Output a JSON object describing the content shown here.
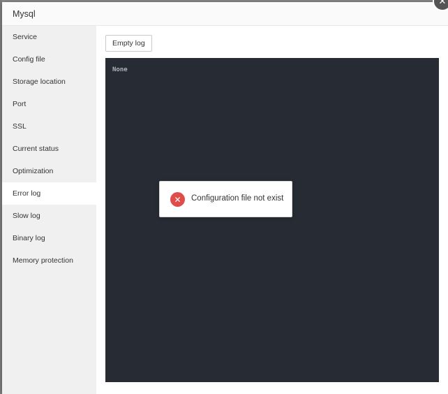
{
  "dialog": {
    "title": "Mysql",
    "close_icon": "close-icon"
  },
  "sidebar": {
    "items": [
      {
        "label": "Service"
      },
      {
        "label": "Config file"
      },
      {
        "label": "Storage location"
      },
      {
        "label": "Port"
      },
      {
        "label": "SSL"
      },
      {
        "label": "Current status"
      },
      {
        "label": "Optimization"
      },
      {
        "label": "Error log",
        "active": true
      },
      {
        "label": "Slow log"
      },
      {
        "label": "Binary log"
      },
      {
        "label": "Memory protection"
      }
    ]
  },
  "main": {
    "empty_log_label": "Empty log",
    "log_content": "None"
  },
  "toast": {
    "message": "Configuration file not exist",
    "icon": "error-icon"
  },
  "colors": {
    "log_background": "#272b33",
    "error": "#e04b4b",
    "sidebar_background": "#f0f0f0"
  }
}
